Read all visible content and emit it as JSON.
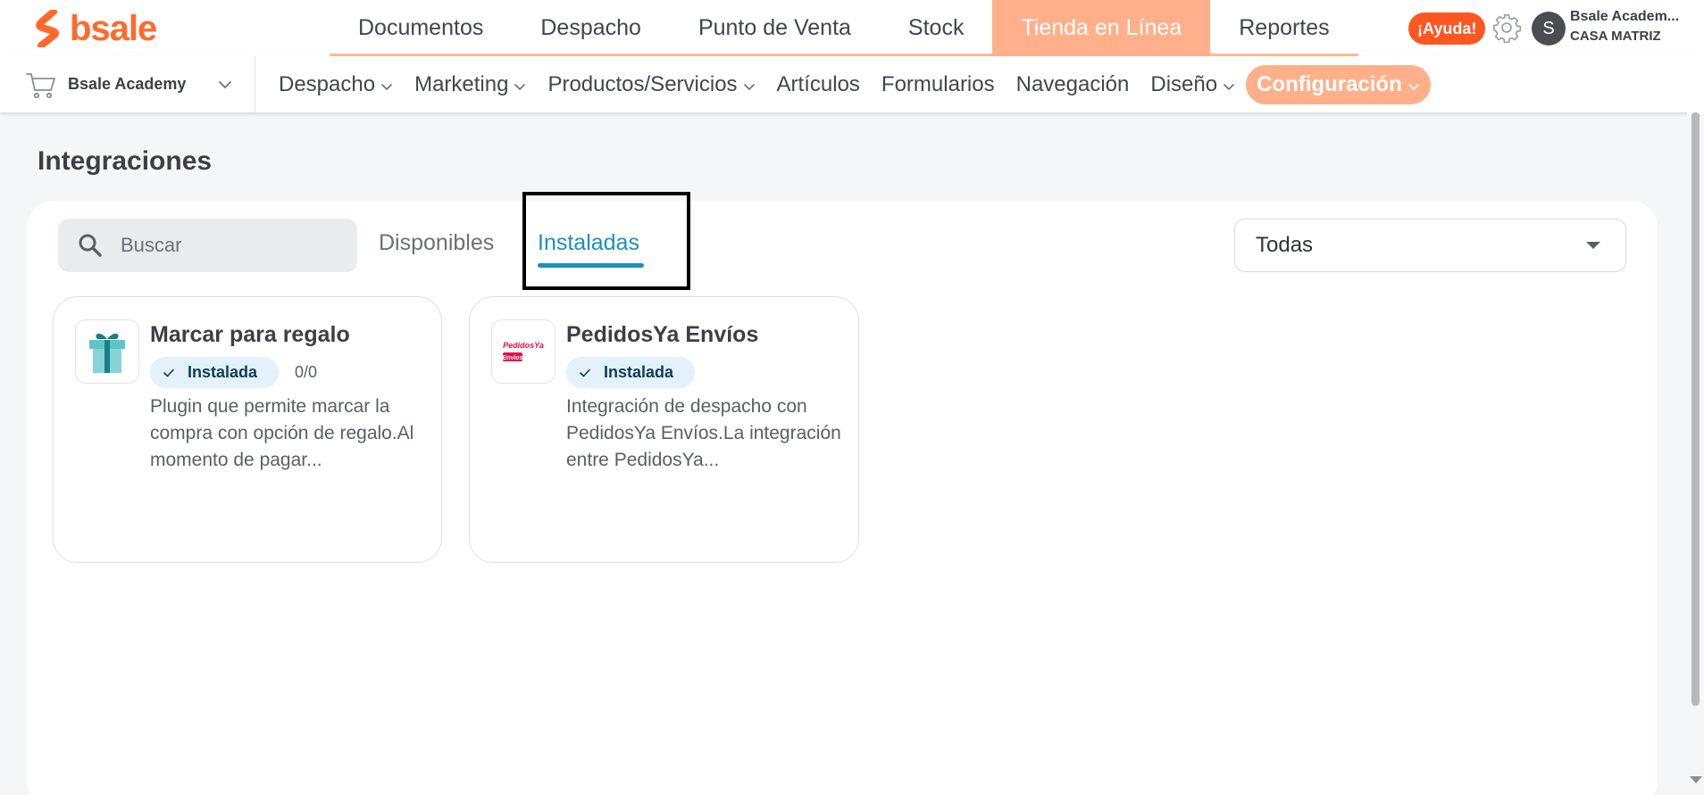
{
  "brand": {
    "name": "bsale",
    "color": "#ff6a2b"
  },
  "top_nav": {
    "items": [
      {
        "label": "Documentos",
        "active": false
      },
      {
        "label": "Despacho",
        "active": false
      },
      {
        "label": "Punto de Venta",
        "active": false
      },
      {
        "label": "Stock",
        "active": false
      },
      {
        "label": "Tienda en Línea",
        "active": true
      },
      {
        "label": "Reportes",
        "active": false
      }
    ]
  },
  "header": {
    "help_label": "¡Ayuda!",
    "avatar_initial": "S",
    "user_name": "Bsale Academ...",
    "branch": "CASA MATRIZ"
  },
  "store_selector": {
    "name": "Bsale Academy"
  },
  "sub_nav": {
    "items": [
      {
        "label": "Despacho",
        "has_dropdown": true,
        "active": false
      },
      {
        "label": "Marketing",
        "has_dropdown": true,
        "active": false
      },
      {
        "label": "Productos/Servicios",
        "has_dropdown": true,
        "active": false
      },
      {
        "label": "Artículos",
        "has_dropdown": false,
        "active": false
      },
      {
        "label": "Formularios",
        "has_dropdown": false,
        "active": false
      },
      {
        "label": "Navegación",
        "has_dropdown": false,
        "active": false
      },
      {
        "label": "Diseño",
        "has_dropdown": true,
        "active": false
      },
      {
        "label": "Configuración",
        "has_dropdown": true,
        "active": true
      }
    ]
  },
  "page": {
    "title": "Integraciones",
    "search_placeholder": "Buscar",
    "tabs": [
      {
        "label": "Disponibles",
        "active": false
      },
      {
        "label": "Instaladas",
        "active": true
      }
    ],
    "filter": {
      "selected": "Todas"
    }
  },
  "integrations": [
    {
      "title": "Marcar para regalo",
      "icon": "gift-icon",
      "status": "Instalada",
      "counter": "0/0",
      "description": "Plugin que permite marcar la compra con opción de regalo.Al momento de pagar..."
    },
    {
      "title": "PedidosYa Envíos",
      "icon": "pedidosya-logo",
      "icon_text": "PedidosYa Envíos",
      "status": "Instalada",
      "description": "Integración de despacho con PedidosYa Envíos.La integración entre PedidosYa..."
    }
  ],
  "colors": {
    "accent_orange": "#ffb08a",
    "help_red": "#ff5722",
    "tab_active_blue": "#1a8fc0",
    "badge_bg": "#e2f1fa"
  }
}
